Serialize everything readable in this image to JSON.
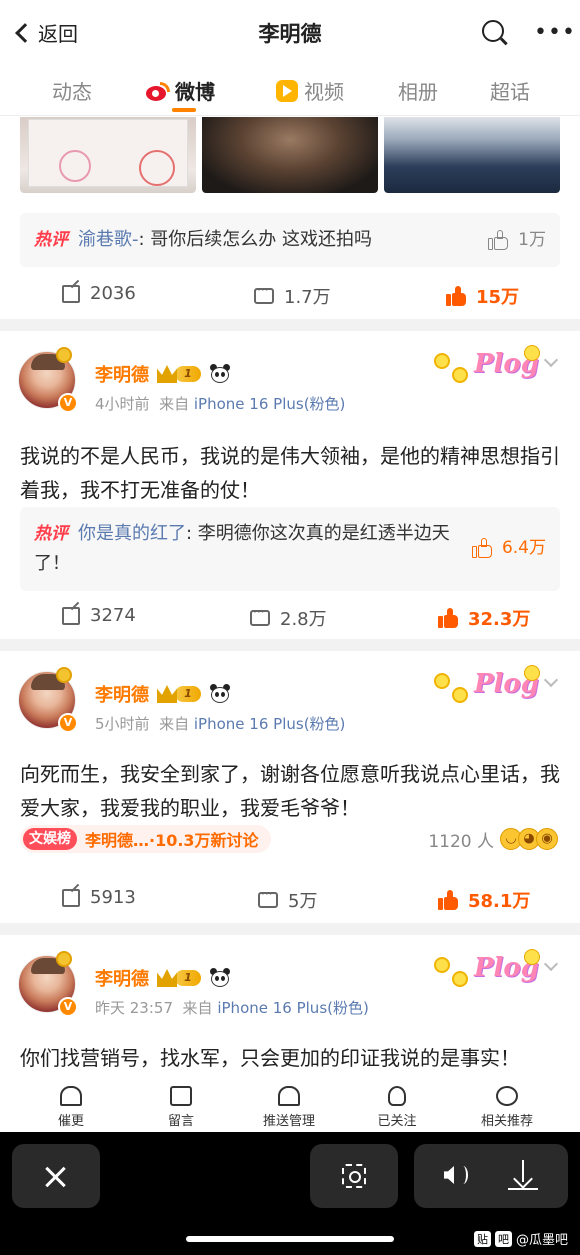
{
  "header": {
    "back_label": "返回",
    "title": "李明德"
  },
  "tabs": [
    "动态",
    "微博",
    "视频",
    "相册",
    "超话"
  ],
  "post0": {
    "hot_label": "热评",
    "hot_user": "渝巷歌-",
    "hot_text": ": 哥你后续怎么办 这戏还拍吗",
    "hot_likes": "1万",
    "shares": "2036",
    "comments": "1.7万",
    "likes": "15万"
  },
  "post1": {
    "username": "李明德",
    "level": "1",
    "time": "4小时前",
    "from": "来自",
    "device": "iPhone 16 Plus",
    "device_suffix": "(粉色)",
    "text": "我说的不是人民币，我说的是伟大领袖，是他的精神思想指引着我，我不打无准备的仗！",
    "hot_label": "热评",
    "hot_user": "你是真的红了",
    "hot_text": ": 李明德你这次真的是红透半边天了！",
    "hot_likes": "6.4万",
    "shares": "3274",
    "comments": "2.8万",
    "likes": "32.3万"
  },
  "post2": {
    "username": "李明德",
    "level": "1",
    "time": "5小时前",
    "from": "来自",
    "device": "iPhone 16 Plus",
    "device_suffix": "(粉色)",
    "text": "向死而生，我安全到家了，谢谢各位愿意听我说点心里话，我爱大家，我爱我的职业，我爱毛爷爷！",
    "topic_tag": "文娱榜",
    "topic_text": "李明德…·10.3万新讨论",
    "topic_count": "1120 人",
    "shares": "5913",
    "comments": "5万",
    "likes": "58.1万"
  },
  "post3": {
    "username": "李明德",
    "level": "1",
    "time": "昨天 23:57",
    "from": "来自",
    "device": "iPhone 16 Plus",
    "device_suffix": "(粉色)",
    "text": "你们找营销号，找水军，只会更加的印证我说的是事实！"
  },
  "decor_word": "Plog",
  "toolbar": [
    "催更",
    "留言",
    "推送管理",
    "已关注",
    "相关推荐"
  ],
  "watermark": {
    "box1": "贴",
    "box2": "吧",
    "text": "@瓜墨吧"
  },
  "colors": {
    "accent": "#ff8200",
    "link": "#5b7bb0",
    "hot": "#ff3d4b",
    "like": "#ff5a00"
  }
}
